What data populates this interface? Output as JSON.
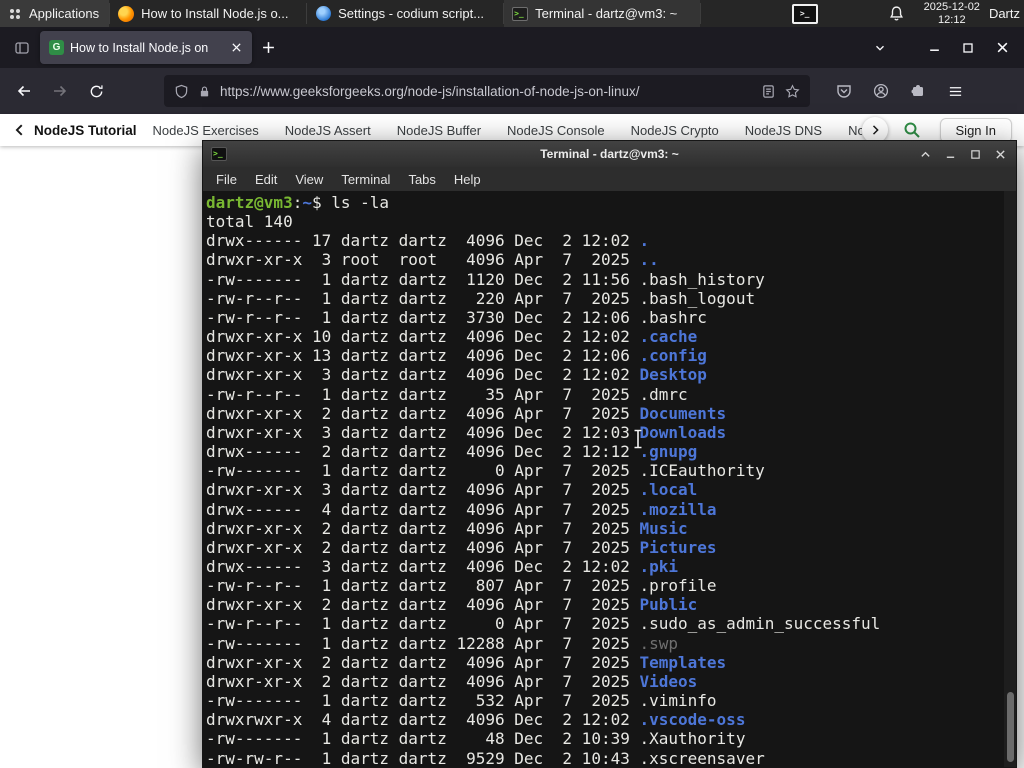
{
  "panel": {
    "applications_label": "Applications",
    "tasks": [
      {
        "title": "How to Install Node.js o...",
        "icon": "firefox-icon"
      },
      {
        "title": "Settings - codium script...",
        "icon": "settings-icon"
      },
      {
        "title": "Terminal - dartz@vm3: ~",
        "icon": "terminal-icon"
      }
    ],
    "clock": {
      "date": "2025-12-02",
      "time": "12:12"
    },
    "user_label": "Dartz"
  },
  "browser": {
    "tab": {
      "title": "How to Install Node.js on",
      "favicon": "geeksforgeeks-icon"
    },
    "url": "https://www.geeksforgeeks.org/node-js/installation-of-node-js-on-linux/"
  },
  "site_nav": {
    "primary_label": "NodeJS Tutorial",
    "links": [
      "NodeJS Exercises",
      "NodeJS Assert",
      "NodeJS Buffer",
      "NodeJS Console",
      "NodeJS Crypto",
      "NodeJS DNS",
      "Node"
    ],
    "sign_in_label": "Sign In",
    "accent_color": "#2f8d46"
  },
  "terminal": {
    "window_title": "Terminal - dartz@vm3: ~",
    "menu": [
      "File",
      "Edit",
      "View",
      "Terminal",
      "Tabs",
      "Help"
    ],
    "prompt": {
      "user_host": "dartz@vm3",
      "separator": ":",
      "cwd": "~",
      "symbol": "$",
      "command": "ls -la"
    },
    "total_line": "total 140",
    "entries": [
      {
        "meta": "drwx------ 17 dartz dartz  4096 Dec  2 12:02 ",
        "name": ".",
        "type": "dir"
      },
      {
        "meta": "drwxr-xr-x  3 root  root   4096 Apr  7  2025 ",
        "name": "..",
        "type": "dir"
      },
      {
        "meta": "-rw-------  1 dartz dartz  1120 Dec  2 11:56 ",
        "name": ".bash_history",
        "type": "file"
      },
      {
        "meta": "-rw-r--r--  1 dartz dartz   220 Apr  7  2025 ",
        "name": ".bash_logout",
        "type": "file"
      },
      {
        "meta": "-rw-r--r--  1 dartz dartz  3730 Dec  2 12:06 ",
        "name": ".bashrc",
        "type": "file"
      },
      {
        "meta": "drwxr-xr-x 10 dartz dartz  4096 Dec  2 12:02 ",
        "name": ".cache",
        "type": "dir"
      },
      {
        "meta": "drwxr-xr-x 13 dartz dartz  4096 Dec  2 12:06 ",
        "name": ".config",
        "type": "dir"
      },
      {
        "meta": "drwxr-xr-x  3 dartz dartz  4096 Dec  2 12:02 ",
        "name": "Desktop",
        "type": "dir"
      },
      {
        "meta": "-rw-r--r--  1 dartz dartz    35 Apr  7  2025 ",
        "name": ".dmrc",
        "type": "file"
      },
      {
        "meta": "drwxr-xr-x  2 dartz dartz  4096 Apr  7  2025 ",
        "name": "Documents",
        "type": "dir"
      },
      {
        "meta": "drwxr-xr-x  3 dartz dartz  4096 Dec  2 12:03 ",
        "name": "Downloads",
        "type": "dir"
      },
      {
        "meta": "drwx------  2 dartz dartz  4096 Dec  2 12:12 ",
        "name": ".gnupg",
        "type": "dir"
      },
      {
        "meta": "-rw-------  1 dartz dartz     0 Apr  7  2025 ",
        "name": ".ICEauthority",
        "type": "file"
      },
      {
        "meta": "drwxr-xr-x  3 dartz dartz  4096 Apr  7  2025 ",
        "name": ".local",
        "type": "dir"
      },
      {
        "meta": "drwx------  4 dartz dartz  4096 Apr  7  2025 ",
        "name": ".mozilla",
        "type": "dir"
      },
      {
        "meta": "drwxr-xr-x  2 dartz dartz  4096 Apr  7  2025 ",
        "name": "Music",
        "type": "dir"
      },
      {
        "meta": "drwxr-xr-x  2 dartz dartz  4096 Apr  7  2025 ",
        "name": "Pictures",
        "type": "dir"
      },
      {
        "meta": "drwx------  3 dartz dartz  4096 Dec  2 12:02 ",
        "name": ".pki",
        "type": "dir"
      },
      {
        "meta": "-rw-r--r--  1 dartz dartz   807 Apr  7  2025 ",
        "name": ".profile",
        "type": "file"
      },
      {
        "meta": "drwxr-xr-x  2 dartz dartz  4096 Apr  7  2025 ",
        "name": "Public",
        "type": "dir"
      },
      {
        "meta": "-rw-r--r--  1 dartz dartz     0 Apr  7  2025 ",
        "name": ".sudo_as_admin_successful",
        "type": "file"
      },
      {
        "meta": "-rw-------  1 dartz dartz 12288 Apr  7  2025 ",
        "name": ".swp",
        "type": "dim"
      },
      {
        "meta": "drwxr-xr-x  2 dartz dartz  4096 Apr  7  2025 ",
        "name": "Templates",
        "type": "dir"
      },
      {
        "meta": "drwxr-xr-x  2 dartz dartz  4096 Apr  7  2025 ",
        "name": "Videos",
        "type": "dir"
      },
      {
        "meta": "-rw-------  1 dartz dartz   532 Apr  7  2025 ",
        "name": ".viminfo",
        "type": "file"
      },
      {
        "meta": "drwxrwxr-x  4 dartz dartz  4096 Dec  2 12:02 ",
        "name": ".vscode-oss",
        "type": "dir"
      },
      {
        "meta": "-rw-------  1 dartz dartz    48 Dec  2 10:39 ",
        "name": ".Xauthority",
        "type": "file"
      },
      {
        "meta": "-rw-rw-r--  1 dartz dartz  9529 Dec  2 10:43 ",
        "name": ".xscreensaver",
        "type": "file"
      }
    ],
    "colors": {
      "background": "#151515",
      "foreground": "#e8e8e4",
      "prompt_green": "#79b832",
      "directory_blue": "#4d76d8",
      "dim_gray": "#707070"
    }
  }
}
